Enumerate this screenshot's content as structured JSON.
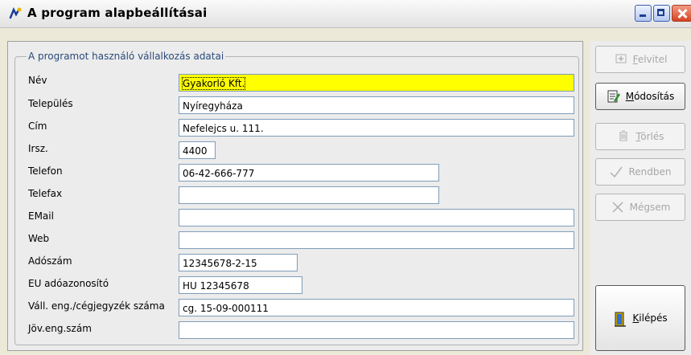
{
  "window": {
    "title": "A program alapbeállításai"
  },
  "group": {
    "legend": "A programot használó vállalkozás adatai"
  },
  "fields": [
    {
      "label": "Név",
      "value": "Gyakorló Kft."
    },
    {
      "label": "Település",
      "value": "Nyíregyháza"
    },
    {
      "label": "Cím",
      "value": "Nefelejcs u. 111."
    },
    {
      "label": "Irsz.",
      "value": "4400"
    },
    {
      "label": "Telefon",
      "value": "06-42-666-777"
    },
    {
      "label": "Telefax",
      "value": ""
    },
    {
      "label": "EMail",
      "value": ""
    },
    {
      "label": "Web",
      "value": ""
    },
    {
      "label": "Adószám",
      "value": "12345678-2-15"
    },
    {
      "label": "EU adóazonosító",
      "value": "HU 12345678"
    },
    {
      "label": "Váll. eng./cégjegyzék száma",
      "value": "cg. 15-09-000111"
    },
    {
      "label": "Jöv.eng.szám",
      "value": ""
    }
  ],
  "buttons": {
    "felvitel": {
      "key": "F",
      "rest": "elvitel",
      "enabled": false,
      "icon": "add-record-icon"
    },
    "modositas": {
      "key": "M",
      "rest": "ódosítás",
      "enabled": true,
      "icon": "edit-record-icon"
    },
    "torles": {
      "key": "T",
      "rest": "örlés",
      "enabled": false,
      "icon": "trash-icon"
    },
    "rendben": {
      "label": "Rendben",
      "enabled": false,
      "icon": "checkmark-icon"
    },
    "megsem": {
      "label": "Mégsem",
      "enabled": false,
      "icon": "cancel-icon"
    },
    "kilepes": {
      "key": "K",
      "rest": "ilépés",
      "enabled": true,
      "icon": "exit-door-icon"
    }
  },
  "colors": {
    "highlight_field": "#ffff00",
    "group_legend": "#2a4a7a",
    "disabled_text": "#a7a7a7"
  }
}
